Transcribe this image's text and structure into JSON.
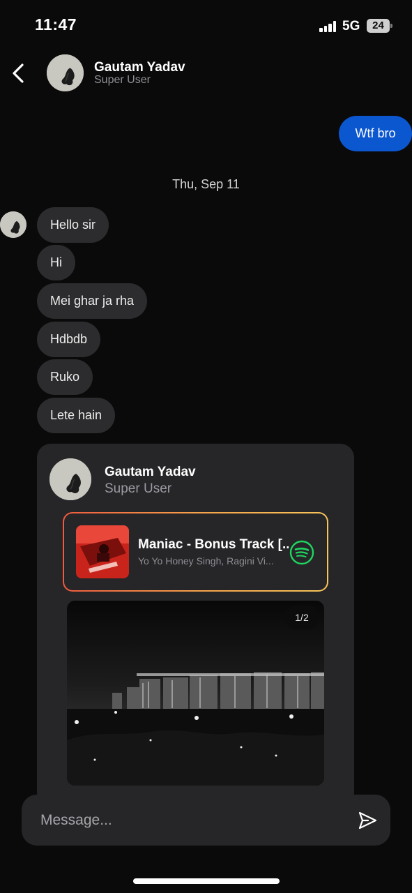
{
  "status_bar": {
    "time": "11:47",
    "network": "5G",
    "battery": "24"
  },
  "header": {
    "name": "Gautam Yadav",
    "subtitle": "Super User"
  },
  "messages": {
    "sent": [
      "Wtf bro"
    ],
    "date_separator": "Thu, Sep 11",
    "received": [
      "Hello sir",
      "Hi",
      "Mei ghar ja rha",
      "Hdbdb",
      "Ruko",
      "Lete hain"
    ]
  },
  "shared_post": {
    "author_name": "Gautam Yadav",
    "author_subtitle": "Super User",
    "music": {
      "title": "Maniac - Bonus Track [...",
      "artist": "Yo Yo Honey Singh, Ragini Vi...",
      "service_icon": "spotify-icon",
      "border_colors": [
        "#f05a3e",
        "#f7a24a",
        "#f7c65a"
      ]
    },
    "page_indicator": "1/2"
  },
  "composer": {
    "placeholder": "Message..."
  },
  "colors": {
    "background": "#0b0a0b",
    "sent_bubble": "#0b57d0",
    "received_bubble": "#2c2c2e",
    "spotify_green": "#1ed760"
  },
  "icons": [
    "back-icon",
    "send-icon",
    "spotify-icon",
    "signal-icon",
    "battery-icon"
  ]
}
